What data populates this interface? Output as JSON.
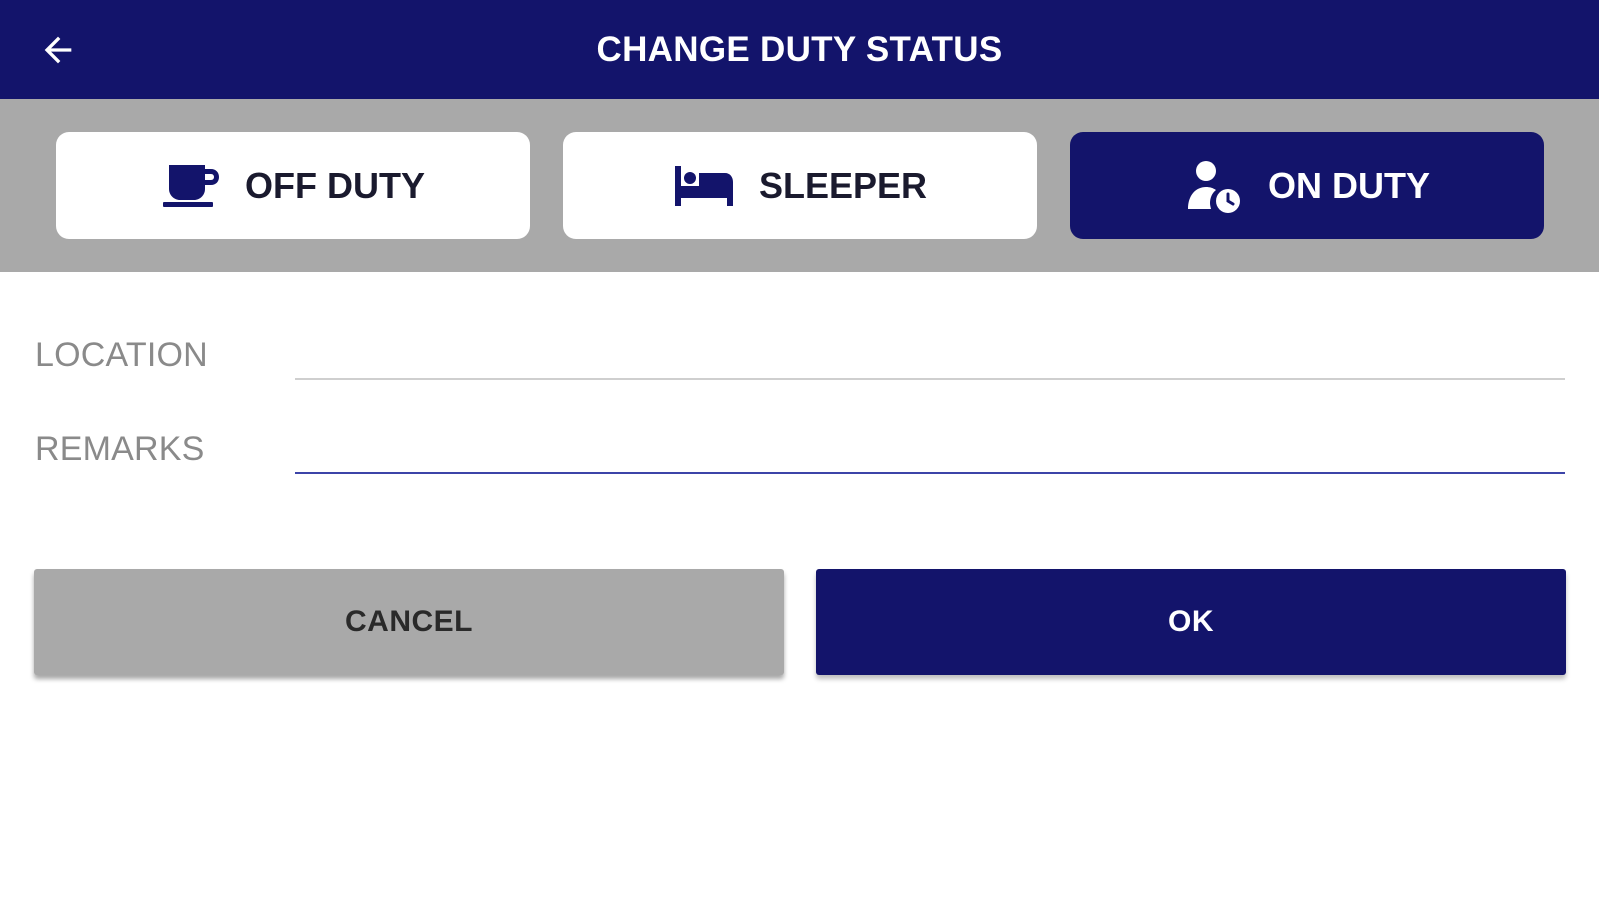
{
  "header": {
    "title": "CHANGE DUTY STATUS",
    "back_icon": "arrow-left-icon"
  },
  "status_options": [
    {
      "label": "OFF DUTY",
      "icon": "coffee-cup-icon",
      "selected": false
    },
    {
      "label": "SLEEPER",
      "icon": "bed-icon",
      "selected": false
    },
    {
      "label": "ON DUTY",
      "icon": "person-clock-icon",
      "selected": true
    }
  ],
  "form": {
    "location": {
      "label": "LOCATION",
      "value": "",
      "placeholder": ""
    },
    "remarks": {
      "label": "REMARKS",
      "value": "",
      "placeholder": ""
    }
  },
  "actions": {
    "cancel_label": "CANCEL",
    "ok_label": "OK"
  },
  "colors": {
    "primary": "#13146b",
    "panel_gray": "#a9a9a9",
    "label_gray": "#8a8a8a",
    "white": "#ffffff"
  }
}
